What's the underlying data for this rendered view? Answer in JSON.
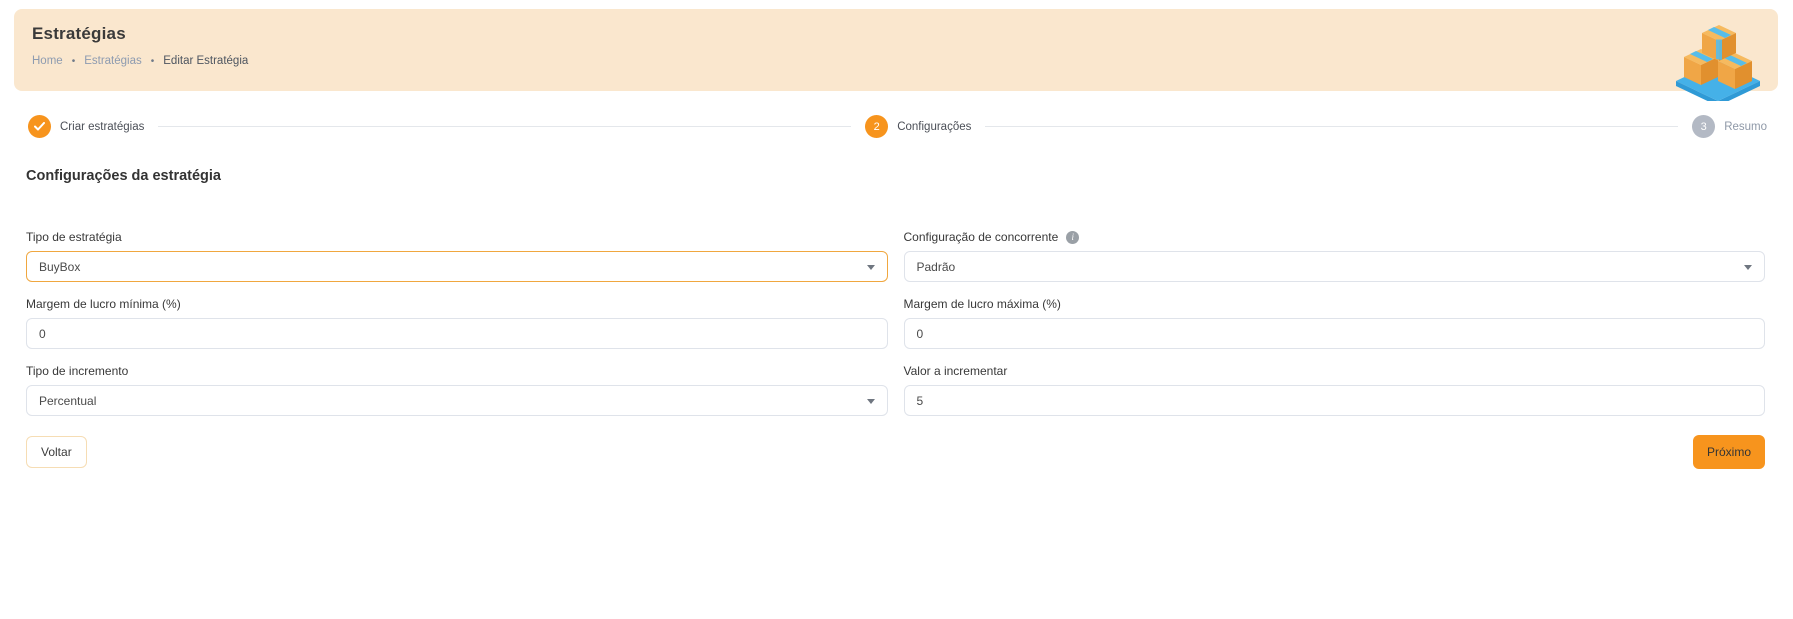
{
  "header": {
    "title": "Estratégias",
    "separator": "•",
    "breadcrumb": [
      {
        "label": "Home"
      },
      {
        "label": "Estratégias"
      },
      {
        "label": "Editar Estratégia"
      }
    ]
  },
  "stepper": {
    "steps": [
      {
        "label": "Criar estratégias",
        "state": "completed"
      },
      {
        "label": "Configurações",
        "state": "active",
        "number": "2"
      },
      {
        "label": "Resumo",
        "state": "upcoming",
        "number": "3"
      }
    ]
  },
  "form": {
    "section_title": "Configurações da estratégia",
    "fields": [
      {
        "label": "Tipo de estratégia",
        "value": "BuyBox",
        "type": "select",
        "highlighted": true
      },
      {
        "label": "Configuração de concorrente",
        "value": "Padrão",
        "type": "select",
        "info": true
      },
      {
        "label": "Margem de lucro mínima (%)",
        "value": "0",
        "type": "input"
      },
      {
        "label": "Margem de lucro máxima (%)",
        "value": "0",
        "type": "input"
      },
      {
        "label": "Tipo de incremento",
        "value": "Percentual",
        "type": "select"
      },
      {
        "label": "Valor a incrementar",
        "value": "5",
        "type": "input"
      }
    ],
    "buttons": {
      "back": "Voltar",
      "next": "Próximo"
    }
  },
  "icons": {
    "info": "i"
  },
  "colors": {
    "accent_orange": "#f7941d",
    "header_background": "#fae7ce",
    "highlighted_field_border": "#f0a73f",
    "field_border": "#dfe3ea",
    "inactive_step": "#b3b9c4",
    "breadcrumb_link": "#8d9bb0"
  }
}
